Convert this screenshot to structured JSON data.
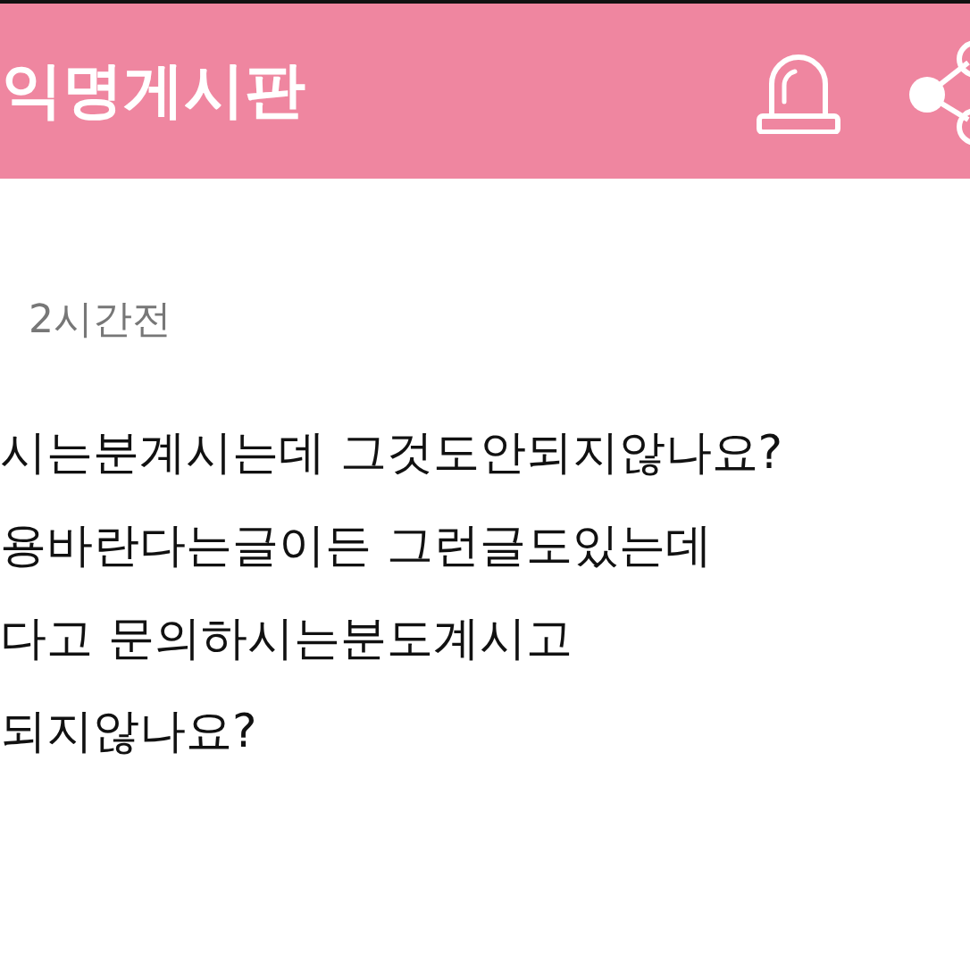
{
  "header": {
    "title": "익명게시판"
  },
  "post": {
    "time": "2시간전",
    "lines": [
      "시는분계시는데 그것도안되지않나요?",
      "용바란다는글이든 그런글도있는데",
      "다고 문의하시는분도계시고",
      "되지않나요?"
    ]
  }
}
